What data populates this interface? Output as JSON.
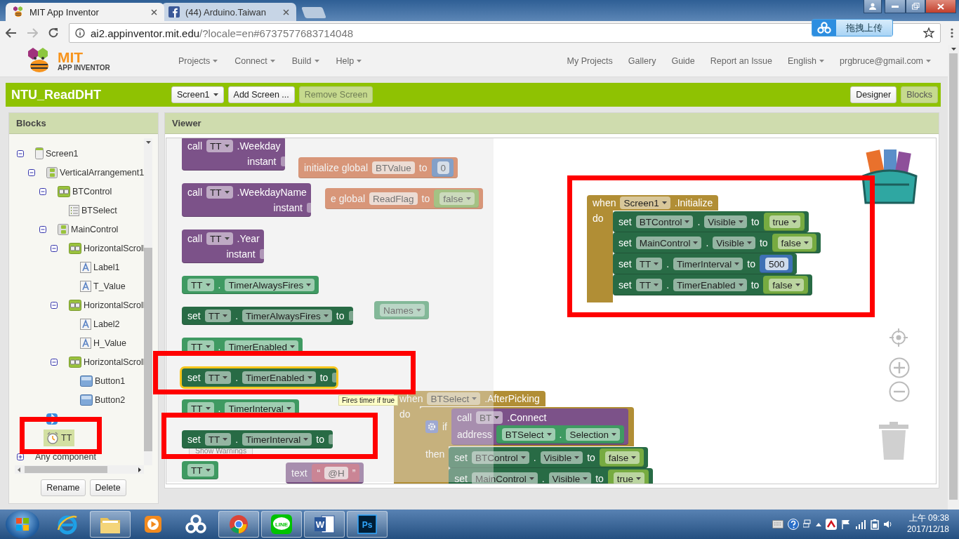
{
  "browser": {
    "tabs": [
      {
        "title": "MIT App Inventor",
        "kind": "bee",
        "selected": true
      },
      {
        "title": "(44) Arduino.Taiwan",
        "kind": "facebook",
        "selected": false
      }
    ],
    "url": {
      "host": "ai2.appinventor.mit.edu",
      "rest": "/?locale=en#6737577683714048"
    },
    "extension_button": "拖拽上传"
  },
  "app": {
    "logo": {
      "title": "MIT",
      "subtitle": "APP INVENTOR"
    },
    "menus": [
      {
        "label": "Projects",
        "dropdown": true
      },
      {
        "label": "Connect",
        "dropdown": true
      },
      {
        "label": "Build",
        "dropdown": true
      },
      {
        "label": "Help",
        "dropdown": true
      }
    ],
    "links": [
      {
        "label": "My Projects",
        "dropdown": false
      },
      {
        "label": "Gallery",
        "dropdown": false
      },
      {
        "label": "Guide",
        "dropdown": false
      },
      {
        "label": "Report an Issue",
        "dropdown": false
      },
      {
        "label": "English",
        "dropdown": true
      },
      {
        "label": "prgbruce@gmail.com",
        "dropdown": true
      }
    ]
  },
  "project": {
    "name": "NTU_ReadDHT",
    "screen_buttons": [
      {
        "label": "Screen1",
        "kind": "dropdown",
        "disabled": false
      },
      {
        "label": "Add Screen ...",
        "kind": "button",
        "disabled": false
      },
      {
        "label": "Remove Screen",
        "kind": "button",
        "disabled": true
      }
    ],
    "views": [
      {
        "label": "Designer",
        "selected": false
      },
      {
        "label": "Blocks",
        "selected": true
      }
    ]
  },
  "blocks_panel": {
    "title": "Blocks",
    "tree": [
      {
        "label": "Screen1",
        "kind": "screen",
        "selected": false,
        "expanded": true,
        "children": [
          {
            "label": "VerticalArrangement1",
            "kind": "vertical",
            "selected": false,
            "expanded": true,
            "children": [
              {
                "label": "BTControl",
                "kind": "horizontal",
                "selected": false,
                "expanded": true,
                "children": [
                  {
                    "label": "BTSelect",
                    "kind": "listpicker",
                    "selected": false
                  }
                ]
              },
              {
                "label": "MainControl",
                "kind": "vertical",
                "selected": false,
                "expanded": true,
                "children": [
                  {
                    "label": "HorizontalScroll",
                    "kind": "horizontal",
                    "selected": false,
                    "expanded": true,
                    "children": [
                      {
                        "label": "Label1",
                        "kind": "label",
                        "selected": false
                      },
                      {
                        "label": "T_Value",
                        "kind": "label",
                        "selected": false
                      }
                    ]
                  },
                  {
                    "label": "HorizontalScroll",
                    "kind": "horizontal",
                    "selected": false,
                    "expanded": true,
                    "children": [
                      {
                        "label": "Label2",
                        "kind": "label",
                        "selected": false
                      },
                      {
                        "label": "H_Value",
                        "kind": "label",
                        "selected": false
                      }
                    ]
                  },
                  {
                    "label": "HorizontalScroll",
                    "kind": "horizontal",
                    "selected": false,
                    "expanded": true,
                    "children": [
                      {
                        "label": "Button1",
                        "kind": "button",
                        "selected": false
                      },
                      {
                        "label": "Button2",
                        "kind": "button",
                        "selected": false
                      }
                    ]
                  }
                ]
              }
            ]
          },
          {
            "kind": "bluetooth",
            "selected": false
          },
          {
            "label": "TT",
            "kind": "clock",
            "selected": true
          }
        ]
      },
      {
        "label": "Any component",
        "kind": "group",
        "selected": false,
        "expanded": false
      }
    ],
    "buttons": [
      "Rename",
      "Delete"
    ]
  },
  "viewer": {
    "title": "Viewer",
    "drawer": {
      "blocks": [
        {
          "kind": "call",
          "selected": false,
          "sections": [
            {
              "parts": [
                {
                  "kind": "label",
                  "text": "call"
                },
                {
                  "kind": "dropdown",
                  "text": "TT"
                },
                {
                  "kind": "label",
                  "text": ".Weekday"
                }
              ]
            },
            {
              "parts": [
                {
                  "kind": "label",
                  "text": "instant"
                },
                {
                  "kind": "socket"
                }
              ]
            }
          ]
        },
        {
          "kind": "call",
          "selected": false,
          "sections": [
            {
              "parts": [
                {
                  "kind": "label",
                  "text": "call"
                },
                {
                  "kind": "dropdown",
                  "text": "TT"
                },
                {
                  "kind": "label",
                  "text": ".WeekdayName"
                }
              ]
            },
            {
              "parts": [
                {
                  "kind": "label",
                  "text": "instant"
                },
                {
                  "kind": "socket"
                }
              ]
            }
          ]
        },
        {
          "kind": "call",
          "selected": false,
          "sections": [
            {
              "parts": [
                {
                  "kind": "label",
                  "text": "call"
                },
                {
                  "kind": "dropdown",
                  "text": "TT"
                },
                {
                  "kind": "label",
                  "text": ".Year"
                }
              ]
            },
            {
              "parts": [
                {
                  "kind": "label",
                  "text": "instant"
                },
                {
                  "kind": "socket"
                }
              ]
            }
          ]
        },
        {
          "kind": "getter",
          "selected": false,
          "sections": [
            {
              "parts": [
                {
                  "kind": "dropdown",
                  "text": "TT"
                },
                {
                  "kind": "label",
                  "text": "."
                },
                {
                  "kind": "dropdown",
                  "text": "TimerAlwaysFires"
                }
              ]
            }
          ]
        },
        {
          "kind": "setter",
          "selected": false,
          "sections": [
            {
              "parts": [
                {
                  "kind": "label",
                  "text": "set"
                },
                {
                  "kind": "dropdown",
                  "text": "TT"
                },
                {
                  "kind": "label",
                  "text": "."
                },
                {
                  "kind": "dropdown",
                  "text": "TimerAlwaysFires"
                },
                {
                  "kind": "label",
                  "text": "to"
                },
                {
                  "kind": "socket"
                }
              ]
            }
          ]
        },
        {
          "kind": "getter",
          "selected": false,
          "sections": [
            {
              "parts": [
                {
                  "kind": "dropdown",
                  "text": "TT"
                },
                {
                  "kind": "label",
                  "text": "."
                },
                {
                  "kind": "dropdown",
                  "text": "TimerEnabled"
                }
              ]
            }
          ]
        },
        {
          "kind": "setter",
          "selected": true,
          "sections": [
            {
              "parts": [
                {
                  "kind": "label",
                  "text": "set"
                },
                {
                  "kind": "dropdown",
                  "text": "TT"
                },
                {
                  "kind": "label",
                  "text": "."
                },
                {
                  "kind": "dropdown",
                  "text": "TimerEnabled"
                },
                {
                  "kind": "label",
                  "text": "to"
                },
                {
                  "kind": "socket"
                }
              ]
            }
          ]
        },
        {
          "kind": "getter",
          "selected": false,
          "sections": [
            {
              "parts": [
                {
                  "kind": "dropdown",
                  "text": "TT"
                },
                {
                  "kind": "label",
                  "text": "."
                },
                {
                  "kind": "dropdown",
                  "text": "TimerInterval"
                }
              ]
            }
          ]
        },
        {
          "kind": "setter",
          "selected": false,
          "sections": [
            {
              "parts": [
                {
                  "kind": "label",
                  "text": "set"
                },
                {
                  "kind": "dropdown",
                  "text": "TT"
                },
                {
                  "kind": "label",
                  "text": "."
                },
                {
                  "kind": "dropdown",
                  "text": "TimerInterval"
                },
                {
                  "kind": "label",
                  "text": "to"
                },
                {
                  "kind": "socket"
                }
              ]
            }
          ]
        },
        {
          "kind": "getter",
          "selected": false,
          "sections": [
            {
              "parts": [
                {
                  "kind": "dropdown",
                  "text": "TT"
                }
              ]
            }
          ]
        }
      ]
    },
    "tooltip": "Fires timer if true",
    "workspace": {
      "warnings_button": "Show Warnings",
      "blocks": [
        {
          "kind": "global",
          "sections": [
            {
              "parts": [
                {
                  "kind": "label",
                  "text": "initialize global"
                },
                {
                  "kind": "field",
                  "text": "BTValue"
                },
                {
                  "kind": "label",
                  "text": "to"
                },
                {
                  "kind": "value",
                  "block": {
                    "kind": "number",
                    "sections": [
                      {
                        "parts": [
                          {
                            "kind": "field",
                            "text": "0"
                          }
                        ]
                      }
                    ]
                  }
                }
              ]
            }
          ]
        },
        {
          "kind": "global",
          "sections": [
            {
              "parts": [
                {
                  "kind": "label",
                  "text": "e global"
                },
                {
                  "kind": "field",
                  "text": "ReadFlag"
                },
                {
                  "kind": "label",
                  "text": "to"
                },
                {
                  "kind": "value",
                  "block": {
                    "kind": "logic",
                    "sections": [
                      {
                        "parts": [
                          {
                            "kind": "dropdown",
                            "text": "false"
                          }
                        ]
                      }
                    ]
                  }
                }
              ]
            }
          ]
        },
        {
          "kind": "getter",
          "sections": [
            {
              "parts": [
                {
                  "kind": "dropdown",
                  "text": "Names"
                }
              ]
            }
          ]
        },
        {
          "kind": "call",
          "sections": [
            {
              "parts": [
                {
                  "kind": "label",
                  "text": "text"
                },
                {
                  "kind": "value",
                  "block": {
                    "kind": "text",
                    "sections": [
                      {
                        "parts": [
                          {
                            "kind": "label",
                            "text": "“"
                          },
                          {
                            "kind": "field",
                            "text": "@H"
                          },
                          {
                            "kind": "label",
                            "text": "”"
                          }
                        ]
                      }
                    ]
                  }
                }
              ]
            }
          ]
        },
        {
          "kind": "event",
          "sections": [
            {
              "parts": [
                {
                  "kind": "label",
                  "text": "when"
                },
                {
                  "kind": "dropdown",
                  "text": "Screen1"
                },
                {
                  "kind": "label",
                  "text": ".Initialize"
                }
              ]
            },
            {
              "parts": [
                {
                  "kind": "label",
                  "text": "do"
                }
              ],
              "statements": [
                {
                  "kind": "setter",
                  "sections": [
                    {
                      "parts": [
                        {
                          "kind": "label",
                          "text": "set"
                        },
                        {
                          "kind": "dropdown",
                          "text": "BTControl"
                        },
                        {
                          "kind": "label",
                          "text": "."
                        },
                        {
                          "kind": "dropdown",
                          "text": "Visible"
                        },
                        {
                          "kind": "label",
                          "text": "to"
                        },
                        {
                          "kind": "value",
                          "block": {
                            "kind": "logic",
                            "sections": [
                              {
                                "parts": [
                                  {
                                    "kind": "dropdown",
                                    "text": "true"
                                  }
                                ]
                              }
                            ]
                          }
                        }
                      ]
                    }
                  ]
                },
                {
                  "kind": "setter",
                  "sections": [
                    {
                      "parts": [
                        {
                          "kind": "label",
                          "text": "set"
                        },
                        {
                          "kind": "dropdown",
                          "text": "MainControl"
                        },
                        {
                          "kind": "label",
                          "text": "."
                        },
                        {
                          "kind": "dropdown",
                          "text": "Visible"
                        },
                        {
                          "kind": "label",
                          "text": "to"
                        },
                        {
                          "kind": "value",
                          "block": {
                            "kind": "logic",
                            "sections": [
                              {
                                "parts": [
                                  {
                                    "kind": "dropdown",
                                    "text": "false"
                                  }
                                ]
                              }
                            ]
                          }
                        }
                      ]
                    }
                  ]
                },
                {
                  "kind": "setter",
                  "sections": [
                    {
                      "parts": [
                        {
                          "kind": "label",
                          "text": "set"
                        },
                        {
                          "kind": "dropdown",
                          "text": "TT"
                        },
                        {
                          "kind": "label",
                          "text": "."
                        },
                        {
                          "kind": "dropdown",
                          "text": "TimerInterval"
                        },
                        {
                          "kind": "label",
                          "text": "to"
                        },
                        {
                          "kind": "value",
                          "block": {
                            "kind": "number",
                            "sections": [
                              {
                                "parts": [
                                  {
                                    "kind": "field",
                                    "text": "500"
                                  }
                                ]
                              }
                            ]
                          }
                        }
                      ]
                    }
                  ]
                },
                {
                  "kind": "setter",
                  "sections": [
                    {
                      "parts": [
                        {
                          "kind": "label",
                          "text": "set"
                        },
                        {
                          "kind": "dropdown",
                          "text": "TT"
                        },
                        {
                          "kind": "label",
                          "text": "."
                        },
                        {
                          "kind": "dropdown",
                          "text": "TimerEnabled"
                        },
                        {
                          "kind": "label",
                          "text": "to"
                        },
                        {
                          "kind": "value",
                          "block": {
                            "kind": "logic",
                            "sections": [
                              {
                                "parts": [
                                  {
                                    "kind": "dropdown",
                                    "text": "false"
                                  }
                                ]
                              }
                            ]
                          }
                        }
                      ]
                    }
                  ]
                }
              ]
            }
          ]
        },
        {
          "kind": "event",
          "sections": [
            {
              "parts": [
                {
                  "kind": "label",
                  "text": "when"
                },
                {
                  "kind": "dropdown",
                  "text": "BTSelect"
                },
                {
                  "kind": "label",
                  "text": ".AfterPicking"
                }
              ]
            },
            {
              "parts": [
                {
                  "kind": "label",
                  "text": "do"
                }
              ],
              "statements": [
                {
                  "kind": "if",
                  "sections": [
                    {
                      "parts": [
                        {
                          "kind": "mutator"
                        },
                        {
                          "kind": "label",
                          "text": "if"
                        },
                        {
                          "kind": "value",
                          "block": {
                            "kind": "call",
                            "sections": [
                              {
                                "parts": [
                                  {
                                    "kind": "label",
                                    "text": "call"
                                  },
                                  {
                                    "kind": "dropdown",
                                    "text": "BT"
                                  },
                                  {
                                    "kind": "label",
                                    "text": ".Connect"
                                  }
                                ]
                              },
                              {
                                "parts": [
                                  {
                                    "kind": "label",
                                    "text": "address"
                                  },
                                  {
                                    "kind": "value",
                                    "block": {
                                      "kind": "getter",
                                      "sections": [
                                        {
                                          "parts": [
                                            {
                                              "kind": "dropdown",
                                              "text": "BTSelect"
                                            },
                                            {
                                              "kind": "label",
                                              "text": "."
                                            },
                                            {
                                              "kind": "dropdown",
                                              "text": "Selection"
                                            }
                                          ]
                                        }
                                      ]
                                    }
                                  }
                                ]
                              }
                            ]
                          }
                        }
                      ]
                    },
                    {
                      "parts": [
                        {
                          "kind": "label",
                          "text": "then"
                        }
                      ],
                      "statements": [
                        {
                          "kind": "setter",
                          "sections": [
                            {
                              "parts": [
                                {
                                  "kind": "label",
                                  "text": "set"
                                },
                                {
                                  "kind": "dropdown",
                                  "text": "BTControl"
                                },
                                {
                                  "kind": "label",
                                  "text": "."
                                },
                                {
                                  "kind": "dropdown",
                                  "text": "Visible"
                                },
                                {
                                  "kind": "label",
                                  "text": "to"
                                },
                                {
                                  "kind": "value",
                                  "block": {
                                    "kind": "logic",
                                    "sections": [
                                      {
                                        "parts": [
                                          {
                                            "kind": "dropdown",
                                            "text": "false"
                                          }
                                        ]
                                      }
                                    ]
                                  }
                                }
                              ]
                            }
                          ]
                        },
                        {
                          "kind": "setter",
                          "sections": [
                            {
                              "parts": [
                                {
                                  "kind": "label",
                                  "text": "set"
                                },
                                {
                                  "kind": "dropdown",
                                  "text": "MainControl"
                                },
                                {
                                  "kind": "label",
                                  "text": "."
                                },
                                {
                                  "kind": "dropdown",
                                  "text": "Visible"
                                },
                                {
                                  "kind": "label",
                                  "text": "to"
                                },
                                {
                                  "kind": "value",
                                  "block": {
                                    "kind": "logic",
                                    "sections": [
                                      {
                                        "parts": [
                                          {
                                            "kind": "dropdown",
                                            "text": "true"
                                          }
                                        ]
                                      }
                                    ]
                                  }
                                }
                              ]
                            }
                          ]
                        }
                      ]
                    }
                  ]
                }
              ]
            }
          ]
        }
      ]
    }
  },
  "taskbar": {
    "apps": [
      {
        "kind": "ie",
        "running": false
      },
      {
        "kind": "explorer",
        "running": true
      },
      {
        "kind": "media",
        "running": false
      },
      {
        "kind": "cloud",
        "running": false
      },
      {
        "kind": "chrome",
        "running": true
      },
      {
        "kind": "line",
        "label": "LINE",
        "running": true
      },
      {
        "kind": "word",
        "label": "W",
        "running": true
      },
      {
        "kind": "photoshop",
        "label": "Ps",
        "running": true
      }
    ],
    "time": "上午 09:38",
    "date": "2017/12/18"
  }
}
